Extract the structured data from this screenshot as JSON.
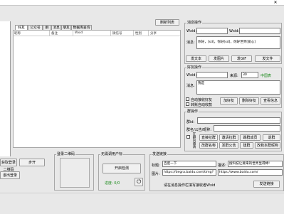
{
  "tabs": [
    "好友",
    "公众号",
    "群",
    "消息",
    "朋友",
    "数据库查询"
  ],
  "table": {
    "columns": [
      "昵称",
      "备注",
      "Wxid",
      "微信号",
      "性别",
      "分享"
    ],
    "refresh_label": "刷新列表"
  },
  "left_buttons": {
    "login_qr": "获取登录二维码",
    "start": "步开",
    "logout": "退出登录"
  },
  "qr_group": {
    "title": "登录二维码"
  },
  "detect_group": {
    "title": "无需调用户标",
    "start_label": "开启检测",
    "status": "进度: 0/0"
  },
  "send_link": {
    "title": "发送链接",
    "title_label": "标题:",
    "title_value": "百度一下",
    "desc_label": "描述:",
    "desc_value": "搜科技让要来的世界显得棒!",
    "image_label": "图片:",
    "image_value": "https://tiegra.baidu.com/timg?",
    "link_value": "https://www.baidu.com/",
    "hint": "请在消息操作栏填写接收者Wxid",
    "send_label": "发送链接"
  },
  "message_op": {
    "title": "消息操作",
    "wxid_label": "Wxid:",
    "wxid_value": "",
    "nickid_label": "Wxid:",
    "nickid_value": "",
    "msg_label": "消息:",
    "msg_value": "你好，[sd]，你好[sd]，你好世界[爱心]",
    "buttons": [
      "发文本",
      "发图片",
      "发GIF",
      "发文件"
    ]
  },
  "friend_op": {
    "title": "好友操作",
    "wxid_label": "Wxid:",
    "source_label": "来源:",
    "source_value": "30",
    "source_hint": "中国表",
    "msg_label": "消息:",
    "msg_value": "我是",
    "auto_accept": "自动接收好友",
    "auto_pay": "转账自动收款",
    "buttons": [
      "加好友",
      "删除好友",
      "查看信息"
    ]
  },
  "group_op": {
    "title": "群操作",
    "group_label": "群id:",
    "name_label": "群名/公告/昵称:",
    "member_label": "在群内邀请",
    "row1": [
      "直接拉群",
      "邀请拉群",
      "踢群成员",
      "退群"
    ],
    "row2": [
      "改群名称",
      "发群公告",
      "建群",
      "改我本群昵称"
    ]
  }
}
